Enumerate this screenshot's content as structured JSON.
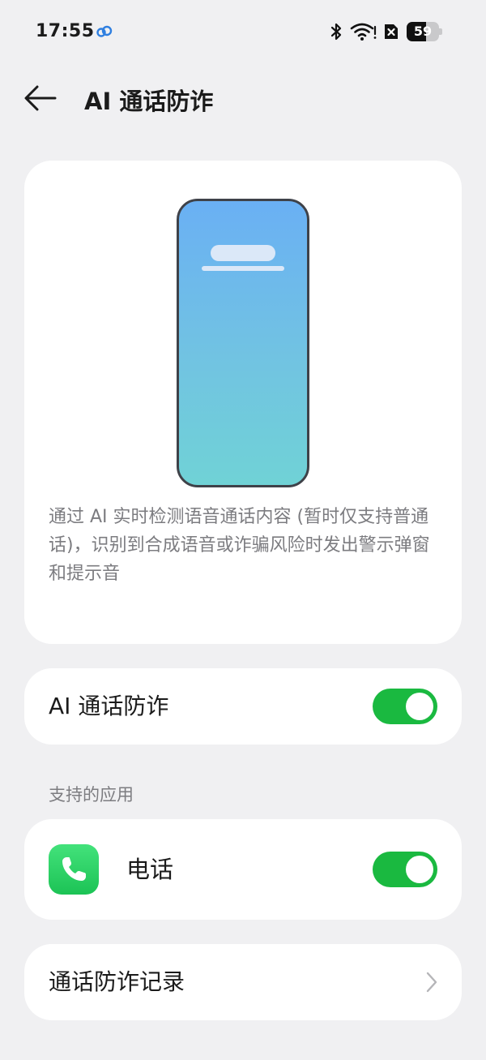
{
  "status_bar": {
    "time": "17:55",
    "battery_level": "59",
    "battery_fraction": 0.59,
    "icons": [
      "cloud-icon",
      "bluetooth-icon",
      "wifi-icon",
      "sim-icon",
      "battery-icon"
    ]
  },
  "header": {
    "back_icon": "arrow-left-icon",
    "title": "AI 通话防诈"
  },
  "hero": {
    "illustration": "phone-illustration",
    "description": "通过 AI 实时检测语音通话内容 (暂时仅支持普通话)，识别到合成语音或诈骗风险时发出警示弹窗和提示音"
  },
  "main_setting": {
    "label": "AI 通话防诈",
    "enabled": true
  },
  "supported_apps": {
    "header": "支持的应用",
    "items": [
      {
        "label": "电话",
        "icon": "phone-icon",
        "enabled": true
      }
    ]
  },
  "records": {
    "label": "通话防诈记录",
    "icon": "chevron-right-icon"
  },
  "colors": {
    "background": "#f0f0f2",
    "card": "#ffffff",
    "toggle_on": "#1ab940",
    "text_primary": "#1b1b1b",
    "text_secondary": "#7c7c80",
    "phone_gradient_top": "#6ab0f4",
    "phone_gradient_bottom": "#70d2d6"
  }
}
